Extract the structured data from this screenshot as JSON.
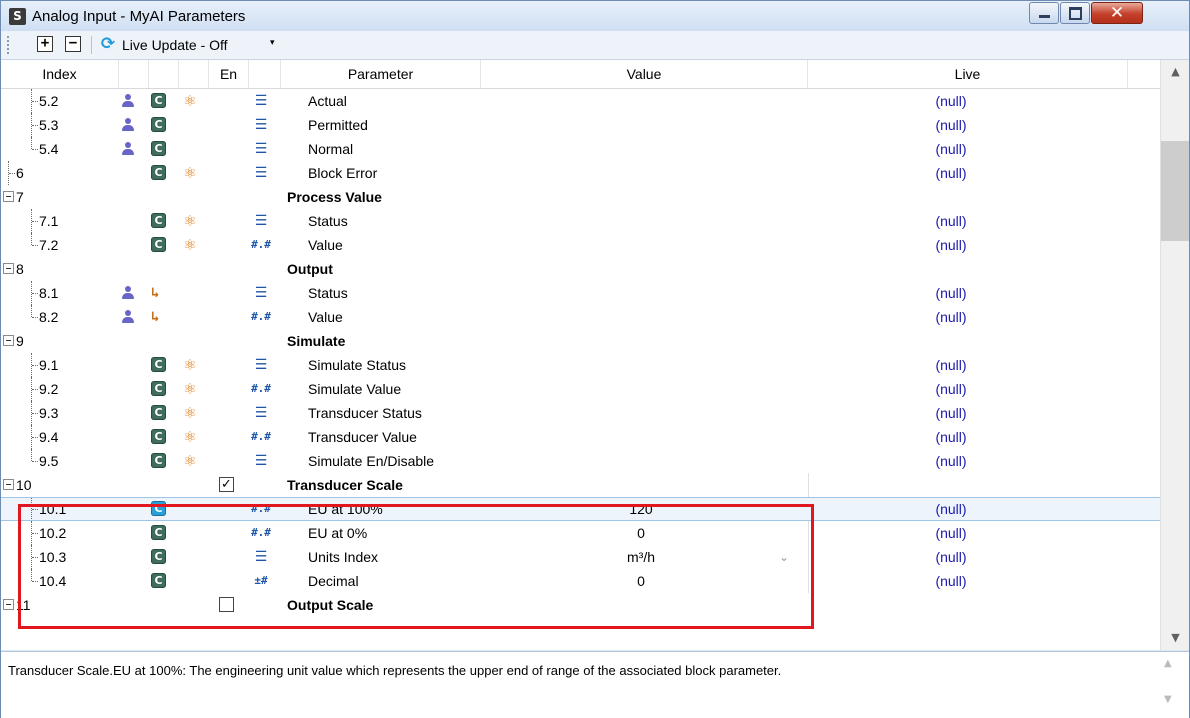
{
  "window": {
    "app_icon_glyph": "S",
    "title": "Analog Input -  MyAI Parameters",
    "close_glyph": "✕"
  },
  "toolbar": {
    "expand_glyph": "+",
    "collapse_glyph": "−",
    "refresh_glyph": "⟳",
    "live_update_label": "Live Update - Off",
    "dropdown_glyph": "▾"
  },
  "columns": {
    "index": "Index",
    "en": "En",
    "parameter": "Parameter",
    "value": "Value",
    "live": "Live"
  },
  "rows": [
    {
      "index": "5.2",
      "parameter": "Actual",
      "value": "",
      "live": "(null)"
    },
    {
      "index": "5.3",
      "parameter": "Permitted",
      "value": "",
      "live": "(null)"
    },
    {
      "index": "5.4",
      "parameter": "Normal",
      "value": "",
      "live": "(null)"
    },
    {
      "index": "6",
      "parameter": "Block Error",
      "value": "",
      "live": "(null)"
    },
    {
      "index": "7",
      "parameter": "Process Value",
      "value": "",
      "live": ""
    },
    {
      "index": "7.1",
      "parameter": "Status",
      "value": "",
      "live": "(null)"
    },
    {
      "index": "7.2",
      "parameter": "Value",
      "value": "",
      "live": "(null)"
    },
    {
      "index": "8",
      "parameter": "Output",
      "value": "",
      "live": ""
    },
    {
      "index": "8.1",
      "parameter": "Status",
      "value": "",
      "live": "(null)"
    },
    {
      "index": "8.2",
      "parameter": "Value",
      "value": "",
      "live": "(null)"
    },
    {
      "index": "9",
      "parameter": "Simulate",
      "value": "",
      "live": ""
    },
    {
      "index": "9.1",
      "parameter": "Simulate Status",
      "value": "",
      "live": "(null)"
    },
    {
      "index": "9.2",
      "parameter": "Simulate Value",
      "value": "",
      "live": "(null)"
    },
    {
      "index": "9.3",
      "parameter": "Transducer Status",
      "value": "",
      "live": "(null)"
    },
    {
      "index": "9.4",
      "parameter": "Transducer Value",
      "value": "",
      "live": "(null)"
    },
    {
      "index": "9.5",
      "parameter": "Simulate En/Disable",
      "value": "",
      "live": "(null)"
    },
    {
      "index": "10",
      "parameter": "Transducer Scale",
      "value": "",
      "live": "",
      "enabled": true
    },
    {
      "index": "10.1",
      "parameter": "EU at 100%",
      "value": "120",
      "live": "(null)"
    },
    {
      "index": "10.2",
      "parameter": "EU at 0%",
      "value": "0",
      "live": "(null)"
    },
    {
      "index": "10.3",
      "parameter": "Units Index",
      "value": "m³/h",
      "live": "(null)"
    },
    {
      "index": "10.4",
      "parameter": "Decimal",
      "value": "0",
      "live": "(null)"
    },
    {
      "index": "11",
      "parameter": "Output Scale",
      "value": "",
      "live": "",
      "enabled": false
    }
  ],
  "icons": {
    "c_badge": "C",
    "atom": "⚛",
    "output": "↳",
    "list_type": "☰",
    "float_type": "#.#",
    "int_type": "±#",
    "checkmark": "✓",
    "combo_arrow": "⌄"
  },
  "scrollbar": {
    "up": "▲",
    "down": "▼"
  },
  "description": {
    "text": "Transducer Scale.EU at 100%: The engineering unit value which represents the upper end of range of the associated block parameter."
  },
  "colors": {
    "live_value": "#1a1aad",
    "highlight_border": "#e1161e",
    "selected_c_badge": "#29a0d8",
    "c_badge": "#3f6e5c",
    "atom_icon": "#e07d1d",
    "user_icon": "#6a64c9"
  }
}
